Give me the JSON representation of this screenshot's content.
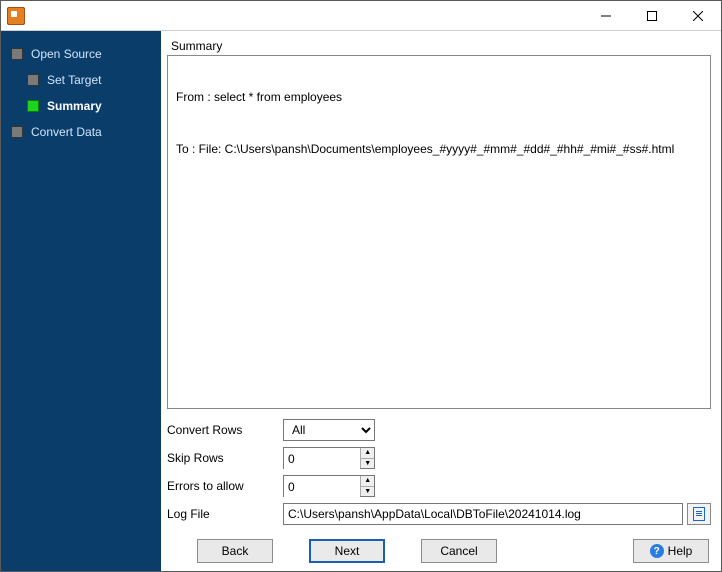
{
  "nav": {
    "items": [
      {
        "label": "Open Source"
      },
      {
        "label": "Set Target"
      },
      {
        "label": "Summary"
      },
      {
        "label": "Convert Data"
      }
    ],
    "active_index": 2
  },
  "summary": {
    "title": "Summary",
    "from_line": "From : select * from employees",
    "to_line": "To : File: C:\\Users\\pansh\\Documents\\employees_#yyyy#_#mm#_#dd#_#hh#_#mi#_#ss#.html"
  },
  "form": {
    "convert_rows": {
      "label": "Convert Rows",
      "value": "All",
      "options": [
        "All"
      ]
    },
    "skip_rows": {
      "label": "Skip Rows",
      "value": "0"
    },
    "errors_allow": {
      "label": "Errors to allow",
      "value": "0"
    },
    "log_file": {
      "label": "Log File",
      "value": "C:\\Users\\pansh\\AppData\\Local\\DBToFile\\20241014.log"
    }
  },
  "buttons": {
    "back": "Back",
    "next": "Next",
    "cancel": "Cancel",
    "help": "Help"
  }
}
